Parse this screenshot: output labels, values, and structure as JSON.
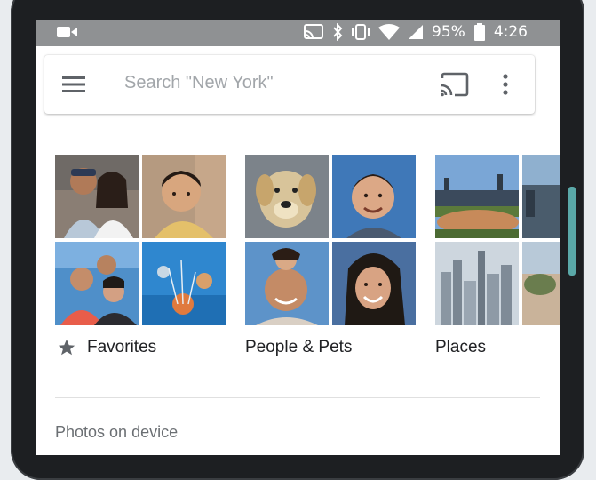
{
  "status_bar": {
    "battery": "95%",
    "time": "4:26"
  },
  "search": {
    "placeholder": "Search \"New York\""
  },
  "icons": {
    "menu": "menu-icon",
    "cast": "cast-icon",
    "more": "more-vert-icon",
    "star": "star-icon"
  },
  "albums": [
    {
      "label": "Favorites"
    },
    {
      "label": "People & Pets"
    },
    {
      "label": "Places"
    }
  ],
  "section": {
    "title": "Photos on device"
  },
  "colors": {
    "status_bar": "#8f9193",
    "accent_teal": "#5aa8a8"
  }
}
